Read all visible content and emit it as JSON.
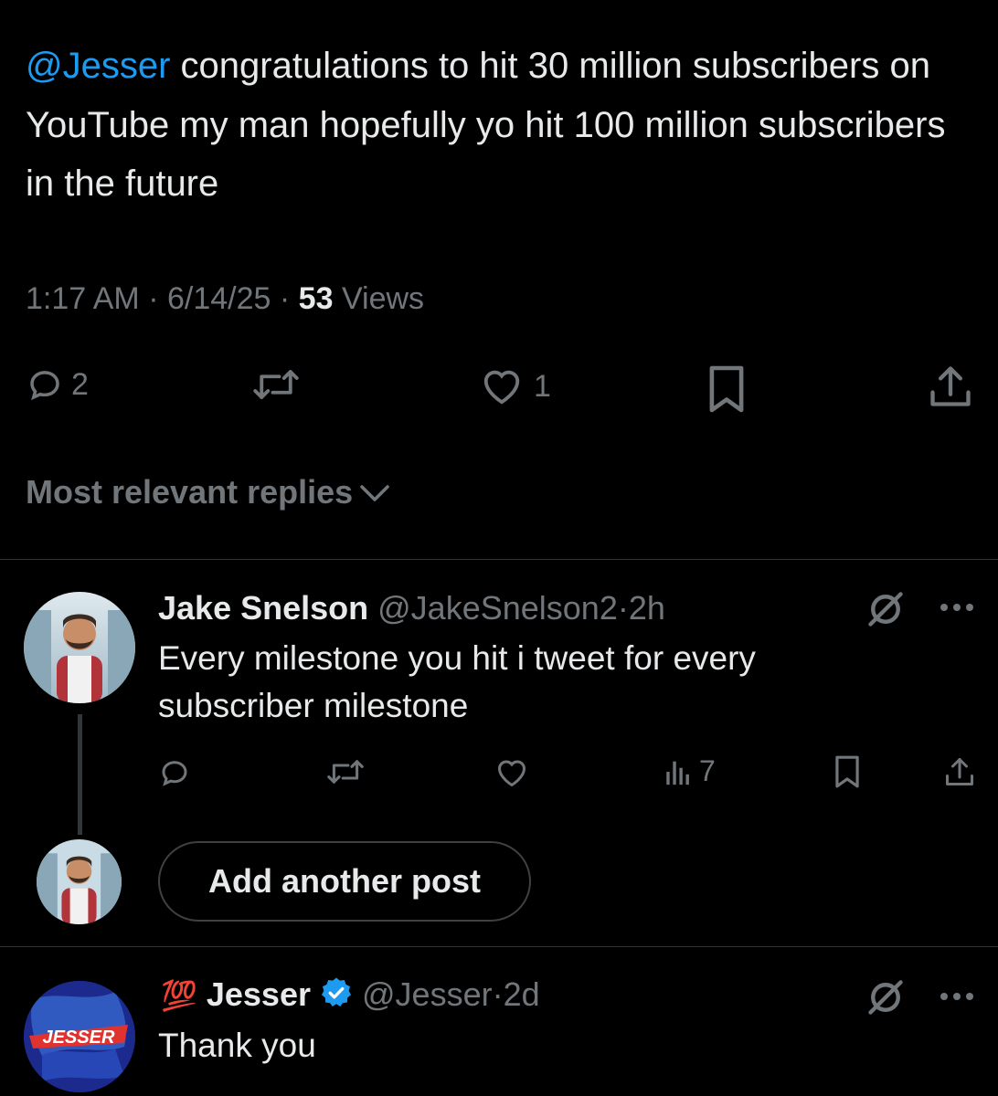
{
  "main_post": {
    "mention": "@Jesser",
    "text": " congratulations to hit 30 million subscribers on YouTube my man hopefully yo hit 100 million subscribers in the future",
    "time": "1:17 AM",
    "date": "6/14/25",
    "views_count": "53",
    "views_label": "Views",
    "actions": {
      "reply_count": "2",
      "like_count": "1"
    }
  },
  "replies_sort": {
    "label": "Most relevant replies"
  },
  "reply_1": {
    "name": "Jake Snelson",
    "handle": "@JakeSnelson2",
    "time": "2h",
    "text": "Every milestone you hit i tweet for every subscriber milestone",
    "views": "7"
  },
  "composer": {
    "button_label": "Add another post"
  },
  "reply_2": {
    "emoji": "💯",
    "name": "Jesser",
    "handle": "@Jesser",
    "time": "2d",
    "text": "Thank you",
    "avatar_logo_text": "JESSER"
  },
  "separator": "·",
  "colors": {
    "background": "#000000",
    "text": "#e7e9ea",
    "secondary": "#71767b",
    "accent": "#1d9bf0",
    "divider": "#2f3336"
  },
  "icons": [
    "reply-icon",
    "retweet-icon",
    "like-icon",
    "bookmark-icon",
    "share-icon",
    "analytics-icon",
    "grok-icon",
    "more-icon",
    "chevron-down-icon",
    "verified-badge-icon"
  ]
}
